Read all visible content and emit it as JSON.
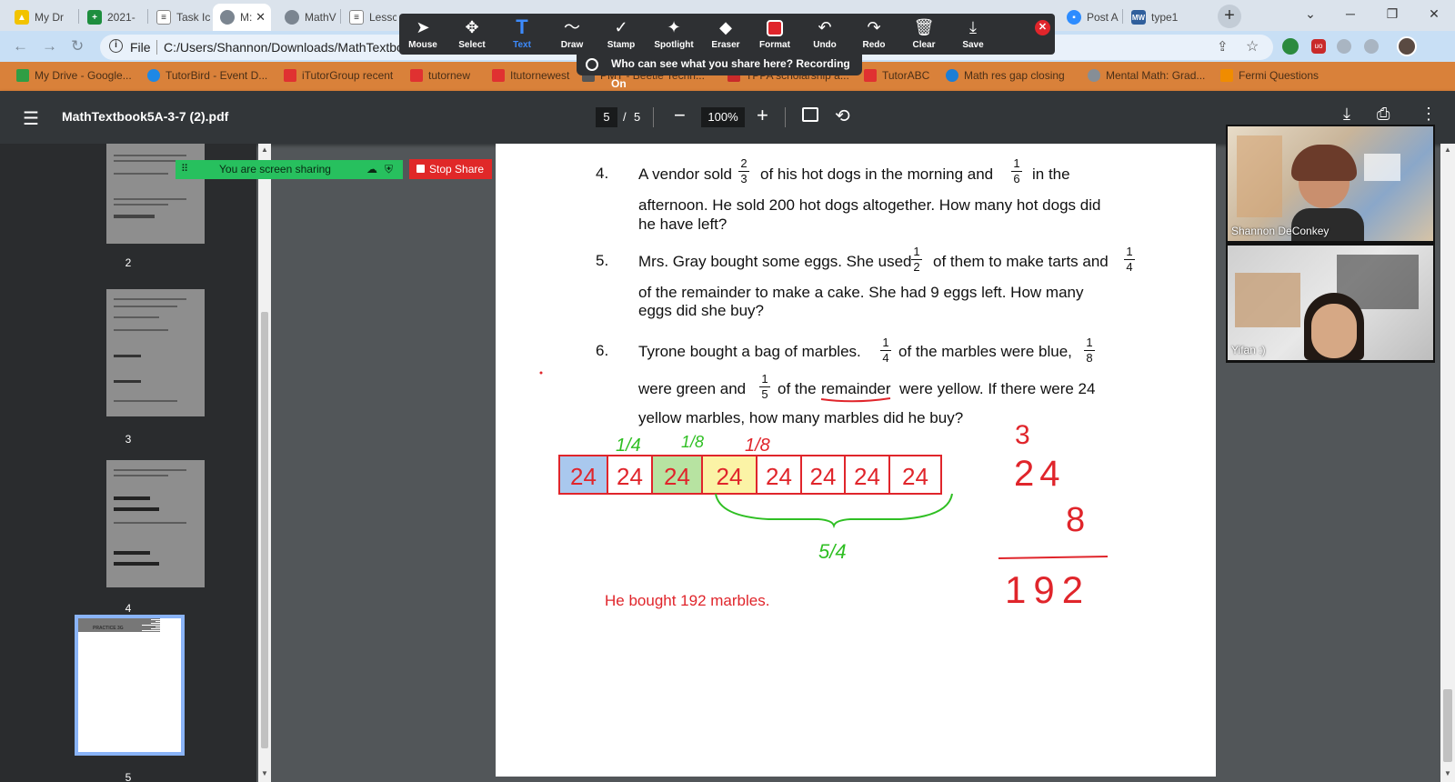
{
  "browser": {
    "tabs": [
      {
        "label": "My Dr",
        "icon": "google-drive-icon",
        "active": false
      },
      {
        "label": "2021-",
        "icon": "google-sheets-icon",
        "active": false
      },
      {
        "label": "Task Ic",
        "icon": "document-icon",
        "active": false
      },
      {
        "label": "M:",
        "icon": "globe-icon",
        "active": true
      },
      {
        "label": "MathV",
        "icon": "globe-icon",
        "active": false
      },
      {
        "label": "Lessc",
        "icon": "document-icon",
        "active": false
      },
      {
        "label": "Post A",
        "icon": "zoom-icon",
        "active": false
      },
      {
        "label": "type1",
        "icon": "merriam-webster-icon",
        "active": false
      }
    ],
    "address": "C:/Users/Shannon/Downloads/MathTextbo",
    "file_label": "File",
    "bookmarks": [
      {
        "label": "My Drive - Google...",
        "color": "#2f9e44"
      },
      {
        "label": "TutorBird - Event D...",
        "color": "#1e88e5"
      },
      {
        "label": "iTutorGroup recent",
        "color": "#e03131"
      },
      {
        "label": "tutornew",
        "color": "#e03131"
      },
      {
        "label": "Itutornewest",
        "color": "#e03131"
      },
      {
        "label": "PMT - Beetle Techn...",
        "color": "#555555"
      },
      {
        "label": "TPPA scholarship a...",
        "color": "#c92a2a"
      },
      {
        "label": "TutorABC",
        "color": "#e03131"
      },
      {
        "label": "Math res gap closing",
        "color": "#1c7ed6"
      },
      {
        "label": "Mental Math: Grad...",
        "color": "#868e96"
      },
      {
        "label": "Fermi Questions",
        "color": "#f08c00"
      }
    ]
  },
  "annotation_toolbar": {
    "tools": [
      {
        "label": "Mouse",
        "icon": "cursor-icon"
      },
      {
        "label": "Select",
        "icon": "move-icon"
      },
      {
        "label": "Text",
        "icon": "text-icon"
      },
      {
        "label": "Draw",
        "icon": "draw-icon"
      },
      {
        "label": "Stamp",
        "icon": "check-icon"
      },
      {
        "label": "Spotlight",
        "icon": "spotlight-icon"
      },
      {
        "label": "Eraser",
        "icon": "eraser-icon"
      },
      {
        "label": "Format",
        "icon": "format-icon"
      },
      {
        "label": "Undo",
        "icon": "undo-icon"
      },
      {
        "label": "Redo",
        "icon": "redo-icon"
      },
      {
        "label": "Clear",
        "icon": "trash-icon"
      },
      {
        "label": "Save",
        "icon": "save-icon"
      }
    ],
    "active_tool": "Text",
    "active_color": "#e0252b",
    "recording_banner": "Who can see what you share here? Recording On"
  },
  "pdf_viewer": {
    "filename": "MathTextbook5A-3-7 (2).pdf",
    "current_page": "5",
    "page_separator": "/",
    "total_pages": "5",
    "zoom": "100%",
    "thumbnails": [
      "2",
      "3",
      "4",
      "5"
    ],
    "selected_thumbnail": "5",
    "thumb5_heading": "PRACTICE 3G"
  },
  "zoom_share": {
    "status": "You are screen sharing",
    "stop_label": "Stop Share"
  },
  "document": {
    "q4": {
      "num": "4.",
      "l1a": "A vendor sold",
      "f1n": "2",
      "f1d": "3",
      "l1b": "of his hot dogs in the morning and",
      "f2n": "1",
      "f2d": "6",
      "l1c": "in the",
      "l2": "afternoon. He sold 200 hot dogs altogether. How many hot dogs did",
      "l3": "he have left?"
    },
    "q5": {
      "num": "5.",
      "l1a": "Mrs. Gray bought some eggs. She used",
      "f1n": "1",
      "f1d": "2",
      "l1b": "of them to make tarts and",
      "f2n": "1",
      "f2d": "4",
      "l2": "of the remainder to make a cake. She had 9 eggs left. How many",
      "l3": "eggs did she buy?"
    },
    "q6": {
      "num": "6.",
      "l1a": "Tyrone bought a bag of marbles.",
      "f1n": "1",
      "f1d": "4",
      "l1b": "of the marbles were blue,",
      "f2n": "1",
      "f2d": "8",
      "l2a": "were green and",
      "f3n": "1",
      "f3d": "5",
      "l2b": "of the",
      "l2c": "remainder",
      "l2d": "were yellow. If there were 24",
      "l3": "yellow marbles, how many marbles did he buy?"
    }
  },
  "annotations": {
    "label_blue": "1/4",
    "label_green": "1/8",
    "label_yellow": "1/8",
    "bar_cells": [
      "24",
      "24",
      "24",
      "24",
      "24",
      "24",
      "24",
      "24"
    ],
    "bar_colors": [
      "#a9c8ee",
      "#ffffff",
      "#b7e3a1",
      "#fbf3a6",
      "#ffffff",
      "#ffffff",
      "#ffffff",
      "#ffffff"
    ],
    "brace_label": "5/4",
    "calc_top": "3",
    "calc_mid": "24",
    "calc_mult": "8",
    "calc_result": "192",
    "answer": "He bought 192 marbles."
  },
  "participants": [
    {
      "name": "Shannon DeConkey"
    },
    {
      "name": "Yifan :)"
    }
  ]
}
